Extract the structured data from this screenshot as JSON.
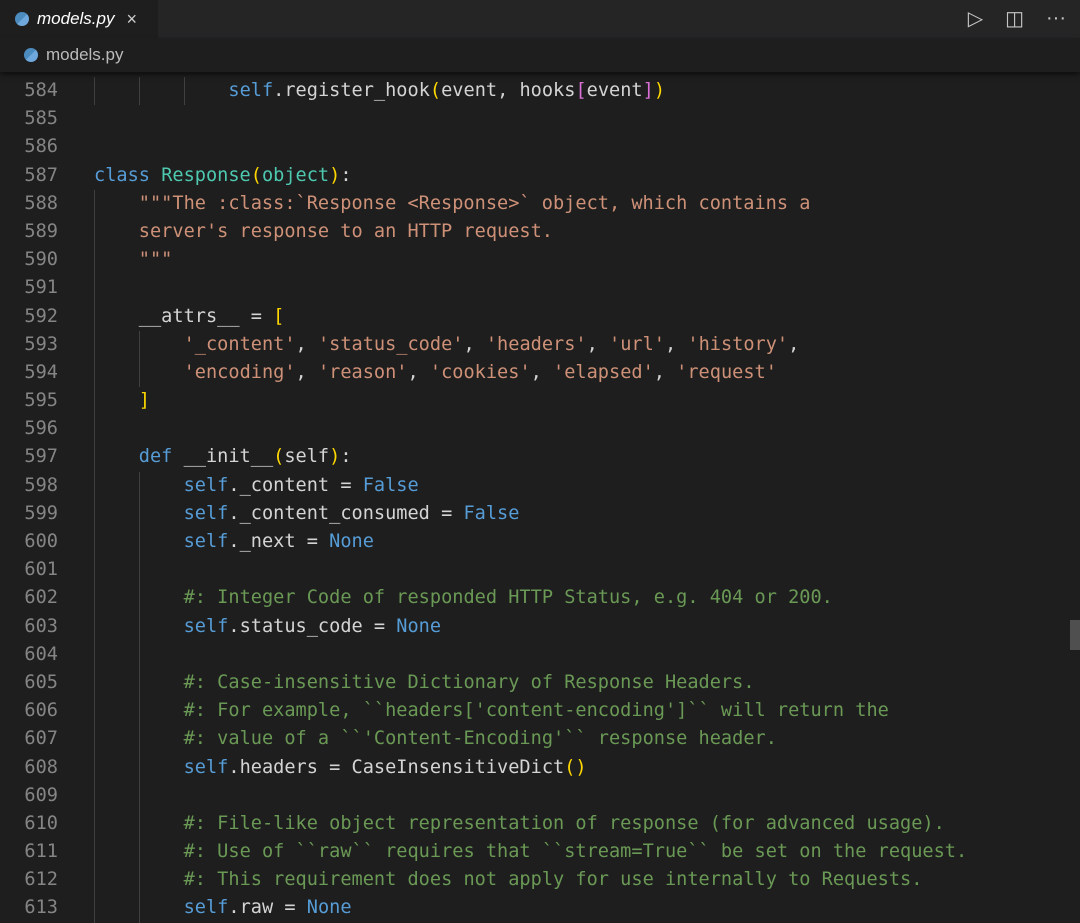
{
  "tab": {
    "label": "models.py",
    "close": "×"
  },
  "breadcrumb": {
    "label": "models.py"
  },
  "actions": {
    "run": "▷",
    "split": "◫",
    "more": "···"
  },
  "colors": {
    "keyword": "#569cd6",
    "class": "#4ec9b0",
    "string": "#ce9178",
    "comment": "#6a9955"
  },
  "lines": [
    {
      "n": "584",
      "indent": 12,
      "guides": 3,
      "t": [
        [
          "self",
          "self"
        ],
        [
          ".register_hook",
          ""
        ],
        [
          "(",
          "b1"
        ],
        [
          "event, hooks",
          ""
        ],
        [
          "[",
          "b2"
        ],
        [
          "event",
          ""
        ],
        [
          "]",
          "b2"
        ],
        [
          ")",
          "b1"
        ]
      ]
    },
    {
      "n": "585",
      "indent": 0,
      "guides": 0,
      "t": []
    },
    {
      "n": "586",
      "indent": 0,
      "guides": 0,
      "t": []
    },
    {
      "n": "587",
      "indent": 0,
      "guides": 0,
      "t": [
        [
          "class",
          "kw"
        ],
        [
          " ",
          ""
        ],
        [
          "Response",
          "cls"
        ],
        [
          "(",
          "b1"
        ],
        [
          "object",
          "cls"
        ],
        [
          ")",
          "b1"
        ],
        [
          ":",
          ""
        ]
      ]
    },
    {
      "n": "588",
      "indent": 4,
      "guides": 1,
      "t": [
        [
          "\"\"\"The :class:`Response <Response>` object, which contains a",
          "str"
        ]
      ]
    },
    {
      "n": "589",
      "indent": 4,
      "guides": 1,
      "t": [
        [
          "server's response to an HTTP request.",
          "str"
        ]
      ]
    },
    {
      "n": "590",
      "indent": 4,
      "guides": 1,
      "t": [
        [
          "\"\"\"",
          "str"
        ]
      ]
    },
    {
      "n": "591",
      "indent": 0,
      "guides": 1,
      "t": []
    },
    {
      "n": "592",
      "indent": 4,
      "guides": 1,
      "t": [
        [
          "__attrs__ = ",
          ""
        ],
        [
          "[",
          "b1"
        ]
      ]
    },
    {
      "n": "593",
      "indent": 8,
      "guides": 2,
      "t": [
        [
          "'_content'",
          "str"
        ],
        [
          ", ",
          ""
        ],
        [
          "'status_code'",
          "str"
        ],
        [
          ", ",
          ""
        ],
        [
          "'headers'",
          "str"
        ],
        [
          ", ",
          ""
        ],
        [
          "'url'",
          "str"
        ],
        [
          ", ",
          ""
        ],
        [
          "'history'",
          "str"
        ],
        [
          ",",
          ""
        ]
      ]
    },
    {
      "n": "594",
      "indent": 8,
      "guides": 2,
      "t": [
        [
          "'encoding'",
          "str"
        ],
        [
          ", ",
          ""
        ],
        [
          "'reason'",
          "str"
        ],
        [
          ", ",
          ""
        ],
        [
          "'cookies'",
          "str"
        ],
        [
          ", ",
          ""
        ],
        [
          "'elapsed'",
          "str"
        ],
        [
          ", ",
          ""
        ],
        [
          "'request'",
          "str"
        ]
      ]
    },
    {
      "n": "595",
      "indent": 4,
      "guides": 1,
      "t": [
        [
          "]",
          "b1"
        ]
      ]
    },
    {
      "n": "596",
      "indent": 0,
      "guides": 1,
      "t": []
    },
    {
      "n": "597",
      "indent": 4,
      "guides": 1,
      "t": [
        [
          "def",
          "kw"
        ],
        [
          " __init__",
          ""
        ],
        [
          "(",
          "b1"
        ],
        [
          "self",
          ""
        ],
        [
          ")",
          "b1"
        ],
        [
          ":",
          ""
        ]
      ]
    },
    {
      "n": "598",
      "indent": 8,
      "guides": 2,
      "t": [
        [
          "self",
          "self"
        ],
        [
          "._content = ",
          ""
        ],
        [
          "False",
          "kw"
        ]
      ]
    },
    {
      "n": "599",
      "indent": 8,
      "guides": 2,
      "t": [
        [
          "self",
          "self"
        ],
        [
          "._content_consumed = ",
          ""
        ],
        [
          "False",
          "kw"
        ]
      ]
    },
    {
      "n": "600",
      "indent": 8,
      "guides": 2,
      "t": [
        [
          "self",
          "self"
        ],
        [
          "._next = ",
          ""
        ],
        [
          "None",
          "kw"
        ]
      ]
    },
    {
      "n": "601",
      "indent": 0,
      "guides": 2,
      "t": []
    },
    {
      "n": "602",
      "indent": 8,
      "guides": 2,
      "t": [
        [
          "#: Integer Code of responded HTTP Status, e.g. 404 or 200.",
          "cmt"
        ]
      ]
    },
    {
      "n": "603",
      "indent": 8,
      "guides": 2,
      "t": [
        [
          "self",
          "self"
        ],
        [
          ".status_code = ",
          ""
        ],
        [
          "None",
          "kw"
        ]
      ]
    },
    {
      "n": "604",
      "indent": 0,
      "guides": 2,
      "t": []
    },
    {
      "n": "605",
      "indent": 8,
      "guides": 2,
      "t": [
        [
          "#: Case-insensitive Dictionary of Response Headers.",
          "cmt"
        ]
      ]
    },
    {
      "n": "606",
      "indent": 8,
      "guides": 2,
      "t": [
        [
          "#: For example, ``headers['content-encoding']`` will return the",
          "cmt"
        ]
      ]
    },
    {
      "n": "607",
      "indent": 8,
      "guides": 2,
      "t": [
        [
          "#: value of a ``'Content-Encoding'`` response header.",
          "cmt"
        ]
      ]
    },
    {
      "n": "608",
      "indent": 8,
      "guides": 2,
      "t": [
        [
          "self",
          "self"
        ],
        [
          ".headers = CaseInsensitiveDict",
          ""
        ],
        [
          "()",
          "b1"
        ]
      ]
    },
    {
      "n": "609",
      "indent": 0,
      "guides": 2,
      "t": []
    },
    {
      "n": "610",
      "indent": 8,
      "guides": 2,
      "t": [
        [
          "#: File-like object representation of response (for advanced usage).",
          "cmt"
        ]
      ]
    },
    {
      "n": "611",
      "indent": 8,
      "guides": 2,
      "t": [
        [
          "#: Use of ``raw`` requires that ``stream=True`` be set on the request.",
          "cmt"
        ]
      ]
    },
    {
      "n": "612",
      "indent": 8,
      "guides": 2,
      "t": [
        [
          "#: This requirement does not apply for use internally to Requests.",
          "cmt"
        ]
      ]
    },
    {
      "n": "613",
      "indent": 8,
      "guides": 2,
      "t": [
        [
          "self",
          "self"
        ],
        [
          ".raw = ",
          ""
        ],
        [
          "None",
          "kw"
        ]
      ]
    }
  ]
}
